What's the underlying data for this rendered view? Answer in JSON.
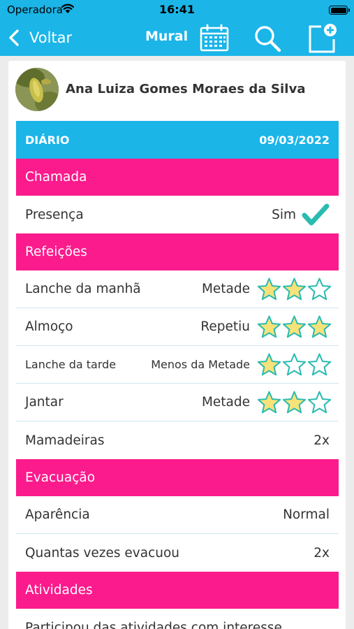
{
  "status": {
    "carrier": "Operadora",
    "time": "16:41"
  },
  "nav": {
    "back_label": "Voltar",
    "title": "Mural",
    "icons": [
      "calendar-icon",
      "search-icon",
      "add-note-icon"
    ]
  },
  "student": {
    "name": "Ana Luiza Gomes Moraes da Silva"
  },
  "diary": {
    "label": "DIÁRIO",
    "date": "09/03/2022"
  },
  "colors": {
    "primary": "#1bb5e8",
    "section": "#fb1b8c",
    "star_fill": "#f7e27a",
    "star_stroke": "#2bbbb0"
  },
  "sections": {
    "chamada": "Chamada",
    "refeicoes": "Refeições",
    "evacuacao": "Evacuação",
    "atividades": "Atividades"
  },
  "presenca": {
    "label": "Presença",
    "value": "Sim"
  },
  "meals": [
    {
      "label": "Lanche da manhã",
      "value": "Metade",
      "stars": 2
    },
    {
      "label": "Almoço",
      "value": "Repetiu",
      "stars": 3
    },
    {
      "label": "Lanche da tarde",
      "value": "Menos da Metade",
      "stars": 1
    },
    {
      "label": "Jantar",
      "value": "Metade",
      "stars": 2
    }
  ],
  "mamadeiras": {
    "label": "Mamadeiras",
    "value": "2x"
  },
  "evacuacao": [
    {
      "label": "Aparência",
      "value": "Normal"
    },
    {
      "label": "Quantas vezes evacuou",
      "value": "2x"
    }
  ],
  "atividades": {
    "label": "Participou das atividades com interesse"
  }
}
